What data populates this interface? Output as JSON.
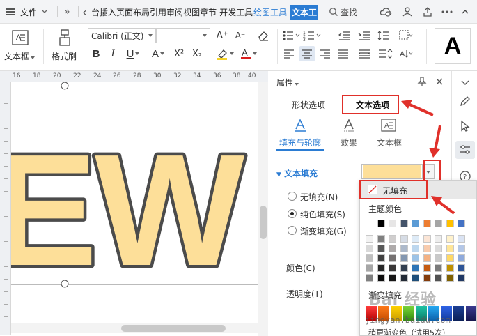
{
  "menubar": {
    "file": "文件",
    "overflow": "»",
    "back": "‹",
    "tabs": [
      "台插入",
      "页面布局",
      "引用",
      "审阅",
      "视图",
      "章节",
      "开发工具"
    ],
    "drawing_tools": "绘图工具",
    "text_tools": "文本工",
    "search": "查找"
  },
  "ribbon": {
    "textbox_label": "文本框",
    "format_painter_label": "格式刷",
    "font_name": "Calibri (正文)",
    "font_size": "",
    "bold": "B",
    "italic": "I",
    "underline": "U",
    "strikethrough": "A",
    "superscript": "X²",
    "subscript": "X₂",
    "grow": "A⁺",
    "shrink": "A⁻",
    "text_style_preview": "A"
  },
  "ruler": {
    "top_ticks": [
      "16",
      "18",
      "20",
      "22",
      "24",
      "26",
      "28",
      "30",
      "32",
      "34",
      "36",
      "38",
      "40"
    ]
  },
  "canvas": {
    "text": "EW",
    "fill_color": "#fddf99",
    "stroke_color": "#4b4b4b"
  },
  "panel": {
    "title": "属性",
    "tabs": [
      "形状选项",
      "文本选项"
    ],
    "subtabs": [
      "填充与轮廓",
      "效果",
      "文本框"
    ],
    "section": "文本填充",
    "radio_none": "无填充(N)",
    "radio_solid": "纯色填充(S)",
    "radio_gradient": "渐变填充(G)",
    "color_label": "颜色(C)",
    "transparency_label": "透明度(T)",
    "fill_swatch_color": "#fddf99"
  },
  "dropdown": {
    "no_fill": "无填充",
    "theme_colors": "主题颜色",
    "gradient_fill": "渐变填充",
    "more_gradient": "稍更渐变色（试用5次）",
    "theme_row": [
      "#ffffff",
      "#000000",
      "#e7e6e6",
      "#44546a",
      "#5b9bd5",
      "#ed7d31",
      "#a5a5a5",
      "#ffc000",
      "#4472c4"
    ],
    "tint_columns": [
      [
        "#f2f2f2",
        "#d9d9d9",
        "#bfbfbf",
        "#a6a6a6",
        "#808080"
      ],
      [
        "#808080",
        "#595959",
        "#404040",
        "#262626",
        "#0d0d0d"
      ],
      [
        "#d0cece",
        "#aeaaaa",
        "#757171",
        "#3a3838",
        "#171616"
      ],
      [
        "#d6dce5",
        "#adb9ca",
        "#8497b0",
        "#333f50",
        "#222a35"
      ],
      [
        "#deebf7",
        "#bdd7ee",
        "#9dc3e6",
        "#2e75b6",
        "#1f4e79"
      ],
      [
        "#fbe5d6",
        "#f8cbad",
        "#f4b183",
        "#c55a11",
        "#843c0c"
      ],
      [
        "#ededed",
        "#dbdbdb",
        "#c9c9c9",
        "#7b7b7b",
        "#525252"
      ],
      [
        "#fff2cc",
        "#ffe699",
        "#ffd966",
        "#bf9000",
        "#7f6000"
      ],
      [
        "#dae3f3",
        "#b4c7e7",
        "#8faadc",
        "#2f5597",
        "#203864"
      ]
    ],
    "gradient_colors": [
      [
        "#ff3b3b",
        "#b30000"
      ],
      [
        "#ff7a1a",
        "#c24a00"
      ],
      [
        "#ffd200",
        "#c79b00"
      ],
      [
        "#7ad33a",
        "#2f8a0c"
      ],
      [
        "#20c3a4",
        "#0a7a66"
      ],
      [
        "#26a9f2",
        "#0b5ea8"
      ],
      [
        "#2e63e6",
        "#123a9c"
      ],
      [
        "#1c3f94",
        "#0b1f55"
      ],
      [
        "#3a3a8f",
        "#15154a"
      ]
    ]
  },
  "watermark": {
    "main": "Bai 经验",
    "sub": "jingyan.baidu.com"
  }
}
